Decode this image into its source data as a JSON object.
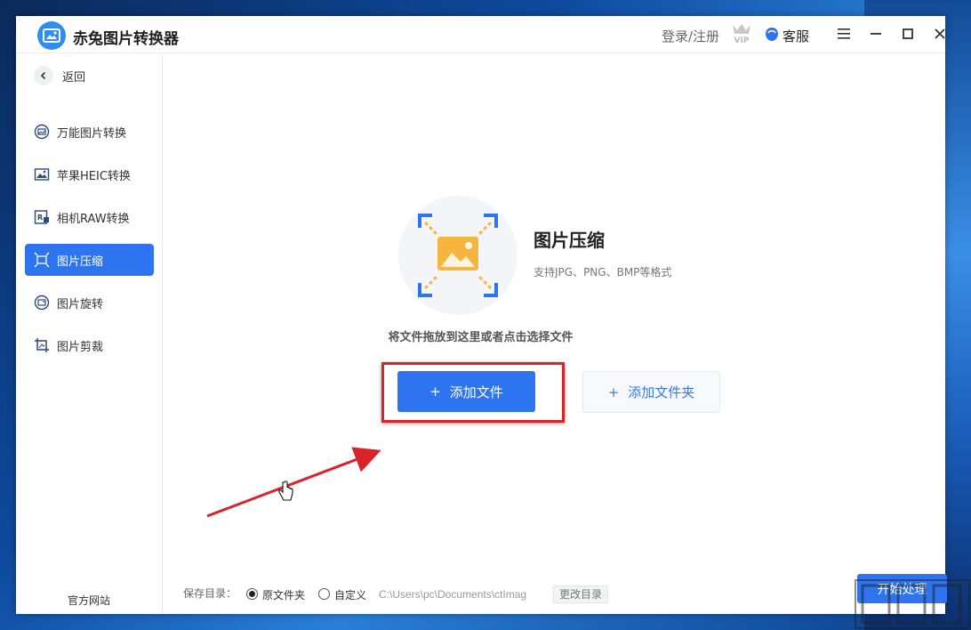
{
  "titlebar": {
    "app_title": "赤兔图片转换器",
    "login_link": "登录/注册",
    "vip_badge": "VIP",
    "service_label": "客服"
  },
  "sidebar": {
    "back_label": "返回",
    "items": [
      {
        "label": "万能图片转换",
        "icon": "universal-convert-icon",
        "active": false
      },
      {
        "label": "苹果HEIC转换",
        "icon": "heic-icon",
        "active": false
      },
      {
        "label": "相机RAW转换",
        "icon": "raw-icon",
        "active": false
      },
      {
        "label": "图片压缩",
        "icon": "compress-icon",
        "active": true
      },
      {
        "label": "图片旋转",
        "icon": "rotate-icon",
        "active": false
      },
      {
        "label": "图片剪裁",
        "icon": "crop-icon",
        "active": false
      }
    ],
    "official_site": "官方网站"
  },
  "main": {
    "feature_title": "图片压缩",
    "feature_desc": "支持JPG、PNG、BMP等格式",
    "drop_hint": "将文件拖放到这里或者点击选择文件",
    "add_file_label": "添加文件",
    "add_folder_label": "添加文件夹",
    "plus": "+"
  },
  "footer": {
    "save_dir_label": "保存目录：",
    "option_original": "原文件夹",
    "option_custom": "自定义",
    "selected_option": "原文件夹",
    "path": "C:\\Users\\pc\\Documents\\ctImag",
    "change_dir_label": "更改目录",
    "start_label": "开始处理"
  },
  "colors": {
    "accent": "#2e74f0",
    "highlight": "#d9232a",
    "icon_orange": "#f5b53f"
  }
}
